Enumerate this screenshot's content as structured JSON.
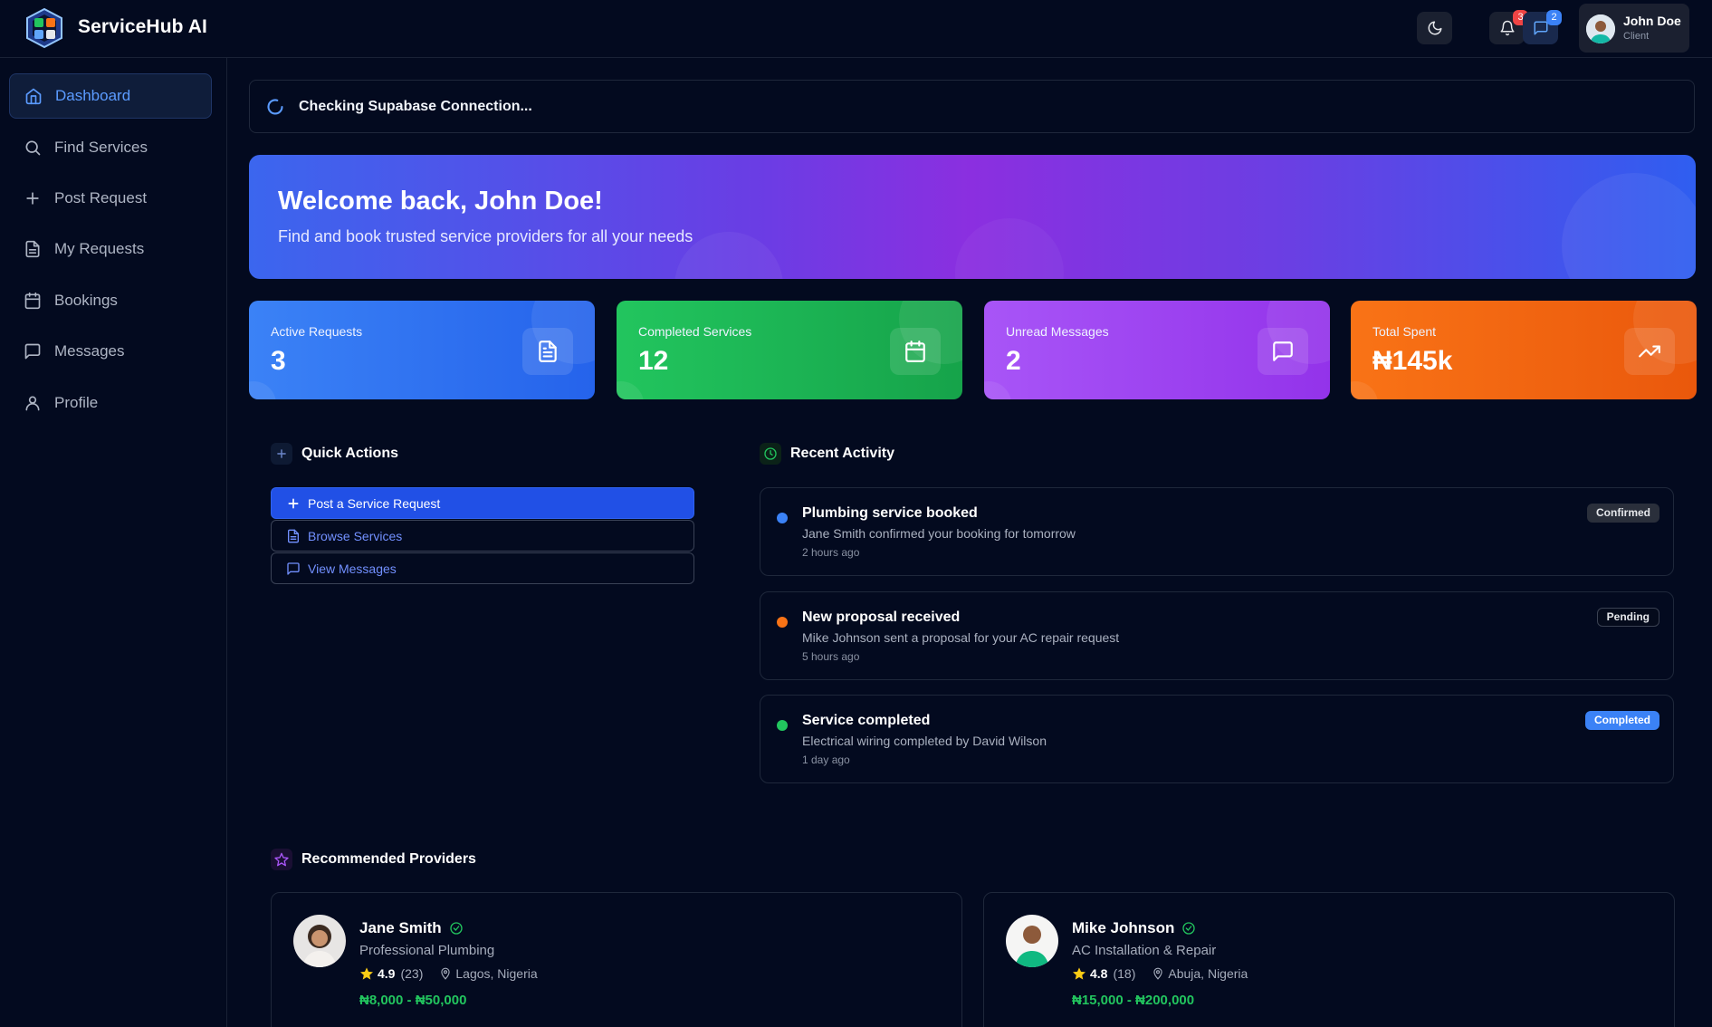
{
  "app": {
    "brand": "ServiceHub AI"
  },
  "topbar": {
    "notifications_count": "3",
    "messages_count": "2",
    "user": {
      "name": "John Doe",
      "role": "Client"
    }
  },
  "sidebar": {
    "items": [
      {
        "label": "Dashboard",
        "icon": "home-icon",
        "active": true
      },
      {
        "label": "Find Services",
        "icon": "search-icon"
      },
      {
        "label": "Post Request",
        "icon": "plus-icon"
      },
      {
        "label": "My Requests",
        "icon": "document-icon"
      },
      {
        "label": "Bookings",
        "icon": "calendar-icon"
      },
      {
        "label": "Messages",
        "icon": "chat-icon"
      },
      {
        "label": "Profile",
        "icon": "user-icon"
      }
    ]
  },
  "connection": {
    "status": "Checking Supabase Connection..."
  },
  "welcome": {
    "title": "Welcome back, John Doe!",
    "subtitle": "Find and book trusted service providers for all your needs"
  },
  "stats": [
    {
      "label": "Active Requests",
      "value": "3",
      "icon": "document-icon",
      "color": "#3b82f6"
    },
    {
      "label": "Completed Services",
      "value": "12",
      "icon": "calendar-icon",
      "color": "#22c55e"
    },
    {
      "label": "Unread Messages",
      "value": "2",
      "icon": "chat-icon",
      "color": "#a855f7"
    },
    {
      "label": "Total Spent",
      "value": "₦145k",
      "icon": "trending-up-icon",
      "color": "#f97316"
    }
  ],
  "quick_actions": {
    "title": "Quick Actions",
    "buttons": [
      {
        "label": "Post a Service Request",
        "icon": "plus-icon"
      },
      {
        "label": "Browse Services",
        "icon": "document-icon"
      },
      {
        "label": "View Messages",
        "icon": "chat-icon"
      }
    ]
  },
  "recent_activity": {
    "title": "Recent Activity",
    "items": [
      {
        "title": "Plumbing service booked",
        "description": "Jane Smith confirmed your booking for tomorrow",
        "time": "2 hours ago",
        "status": "Confirmed",
        "dot_color": "#3b82f6"
      },
      {
        "title": "New proposal received",
        "description": "Mike Johnson sent a proposal for your AC repair request",
        "time": "5 hours ago",
        "status": "Pending",
        "dot_color": "#f97316"
      },
      {
        "title": "Service completed",
        "description": "Electrical wiring completed by David Wilson",
        "time": "1 day ago",
        "status": "Completed",
        "dot_color": "#22c55e"
      }
    ]
  },
  "recommended": {
    "title": "Recommended Providers",
    "providers": [
      {
        "name": "Jane Smith",
        "service": "Professional Plumbing",
        "rating": "4.9",
        "reviews": "(23)",
        "location": "Lagos, Nigeria",
        "price": "₦8,000 - ₦50,000"
      },
      {
        "name": "Mike Johnson",
        "service": "AC Installation & Repair",
        "rating": "4.8",
        "reviews": "(18)",
        "location": "Abuja, Nigeria",
        "price": "₦15,000 - ₦200,000"
      }
    ]
  }
}
